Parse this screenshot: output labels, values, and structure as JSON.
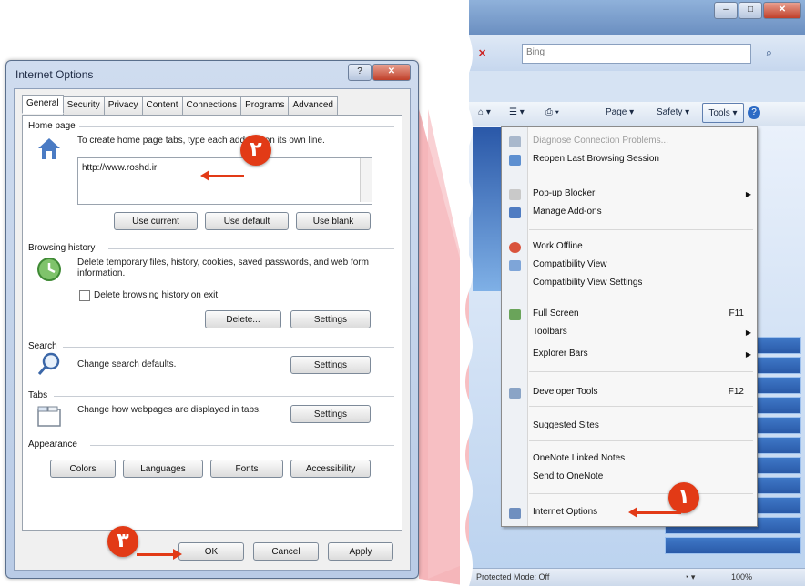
{
  "dialog": {
    "title": "Internet Options",
    "tabs": [
      "General",
      "Security",
      "Privacy",
      "Content",
      "Connections",
      "Programs",
      "Advanced"
    ],
    "home_page": {
      "heading": "Home page",
      "description": "To create home page tabs, type each address on its own line.",
      "url": "http://www.roshd.ir",
      "buttons": [
        "Use current",
        "Use default",
        "Use blank"
      ]
    },
    "browsing_history": {
      "heading": "Browsing history",
      "description": "Delete temporary files, history, cookies, saved passwords, and web form information.",
      "checkbox_label": "Delete browsing history on exit",
      "buttons": [
        "Delete...",
        "Settings"
      ]
    },
    "search": {
      "heading": "Search",
      "description": "Change search defaults.",
      "button": "Settings"
    },
    "tabs_section": {
      "heading": "Tabs",
      "description": "Change how webpages are displayed in tabs.",
      "button": "Settings"
    },
    "appearance": {
      "heading": "Appearance",
      "buttons": [
        "Colors",
        "Languages",
        "Fonts",
        "Accessibility"
      ]
    },
    "footer_buttons": [
      "OK",
      "Cancel",
      "Apply"
    ]
  },
  "markers": {
    "one": "۱",
    "two": "۲",
    "three": "۳"
  },
  "browser": {
    "search_placeholder": "Bing",
    "command_bar": {
      "page": "Page ▾",
      "safety": "Safety ▾",
      "tools": "Tools ▾"
    },
    "tools_menu": [
      {
        "label": "Diagnose Connection Problems...",
        "disabled": true,
        "icon": "diagnose-icon"
      },
      {
        "label": "Reopen Last Browsing Session",
        "icon": "reopen-icon"
      },
      {
        "label": "Pop-up Blocker",
        "submenu": true,
        "icon": "popup-blocker-icon"
      },
      {
        "label": "Manage Add-ons",
        "icon": "addons-icon"
      },
      {
        "label": "Work Offline",
        "icon": "work-offline-icon"
      },
      {
        "label": "Compatibility View",
        "icon": "compatibility-icon"
      },
      {
        "label": "Compatibility View Settings"
      },
      {
        "label": "Full Screen",
        "shortcut": "F11",
        "icon": "fullscreen-icon"
      },
      {
        "label": "Toolbars",
        "submenu": true
      },
      {
        "label": "Explorer Bars",
        "submenu": true
      },
      {
        "label": "Developer Tools",
        "shortcut": "F12",
        "icon": "developer-tools-icon"
      },
      {
        "label": "Suggested Sites"
      },
      {
        "label": "OneNote Linked Notes"
      },
      {
        "label": "Send to OneNote"
      },
      {
        "label": "Internet Options",
        "icon": "internet-options-icon"
      }
    ],
    "status": {
      "protected_mode": "Protected Mode: Off",
      "zoom": "100%"
    }
  },
  "colors": {
    "marker": "#e23a16",
    "menu_bg": "#f7f7f7",
    "dialog_frame": "#b9cbe6"
  }
}
